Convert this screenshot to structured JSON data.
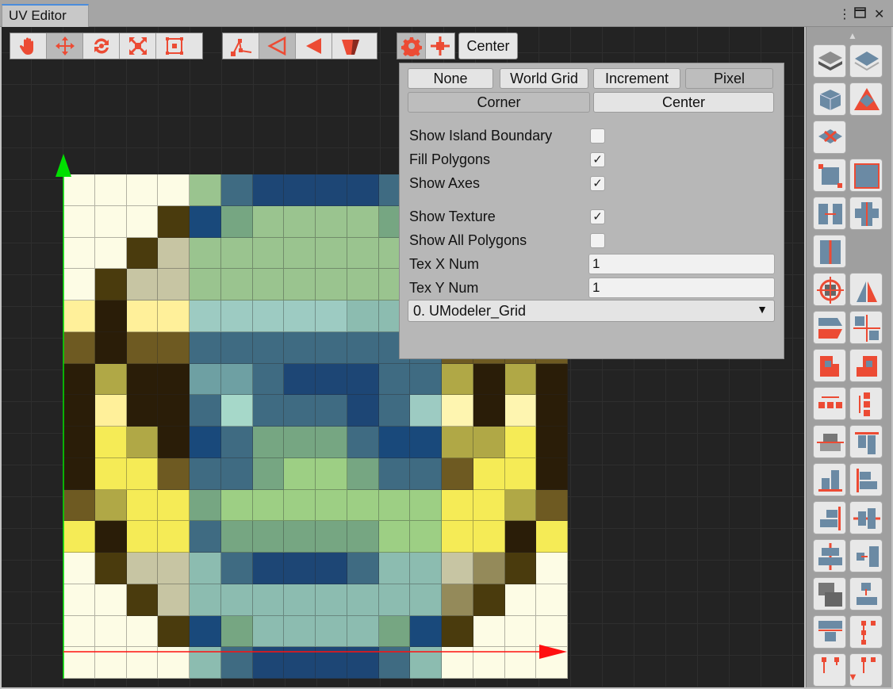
{
  "window": {
    "title": "UV Editor",
    "menu_glyph": "⋮",
    "maximize_glyph": "🗖",
    "close_glyph": "✕"
  },
  "toolbar": {
    "view_tools": [
      {
        "icon": "hand-icon",
        "active": false
      },
      {
        "icon": "move-icon",
        "active": true
      },
      {
        "icon": "rotate-icon",
        "active": false
      },
      {
        "icon": "scale-icon",
        "active": false
      },
      {
        "icon": "rect-transform-icon",
        "active": false
      }
    ],
    "select_modes": [
      {
        "icon": "vertex-select-icon",
        "active": false
      },
      {
        "icon": "edge-select-icon",
        "active": true
      },
      {
        "icon": "face-select-icon",
        "active": false
      },
      {
        "icon": "object-select-icon",
        "active": false
      }
    ],
    "settings_icon": "gear-icon",
    "pivot_icon": "pivot-cross-icon",
    "pivot_label": "Center"
  },
  "panel": {
    "snap_options": [
      "None",
      "World Grid",
      "Increment",
      "Pixel"
    ],
    "snap_selected": "Pixel",
    "pivot_options": [
      "Corner",
      "Center"
    ],
    "pivot_selected": "Corner",
    "options": [
      {
        "label": "Show Island Boundary",
        "checked": false
      },
      {
        "label": "Fill Polygons",
        "checked": true
      },
      {
        "label": "Show Axes",
        "checked": true
      },
      {
        "label": "Show Texture",
        "checked": true
      },
      {
        "label": "Show All Polygons",
        "checked": false
      }
    ],
    "check_glyph": "✓",
    "tex_x_label": "Tex X Num",
    "tex_x_value": "1",
    "tex_y_label": "Tex Y Num",
    "tex_y_value": "1",
    "texture_select": "0. UModeler_Grid",
    "texture_arrow": "▼"
  },
  "texture": {
    "palette": {
      "W": "#fdfce5",
      "D": "#2a1d08",
      "d": "#4a3b0d",
      "O": "#6e5a22",
      "S": "#b0a846",
      "T": "#c7c5a3",
      "Y": "#f5eb56",
      "y": "#fff09a",
      "L": "#fef5b0",
      "K": "#948a5a",
      "g": "#9ac48f",
      "G": "#9dcf84",
      "m": "#76a682",
      "N": "#1d4675",
      "B": "#19497b",
      "b": "#3f6b82",
      "t": "#6ea0a3",
      "c": "#9dcbc2",
      "C": "#a6d8c9",
      "s": "#8cbcb0",
      "P": "#9ad193"
    },
    "rows": [
      "WWWWgbNNNNbWWWWW",
      "WWWdBmggggmWWWWW",
      "WWdTggggggggWWWW",
      "WdTTggggggggTWWW",
      "yDyycccccsscyDyy",
      "ODOObbbbbbbbOOOO",
      "DSDDttbNNNbbSDSD",
      "DyDDbCbbbNbcLDLD",
      "DYSDBbmmmbBBSSYD",
      "DYYObbmGGmbbOYYD",
      "OSYYmGGGGGGGYYSO",
      "YDYYbmmmmmGGYYDY",
      "WdTTsbNNNbssTKdW",
      "WWdTssssssssKdWW",
      "WWWdBmssssmBdWWW",
      "WWWWsbNNNNbsWWWW"
    ]
  },
  "axes": {
    "y_color": "#00e000",
    "x_color": "#ff1010"
  },
  "sidebar": {
    "scroll_up": "▲",
    "scroll_down": "▼",
    "tools": [
      "flatten-plane-icon",
      "project-plane-icon",
      "box-project-icon",
      "triangle-project-icon",
      "remove-uv-icon",
      "",
      "rect-fit-icon",
      "square-fit-icon",
      "split-island-icon",
      "stitch-icon",
      "weld-island-icon",
      "",
      "rotate-island-icon",
      "mirror-island-icon",
      "flip-horizontal-icon",
      "cut-cross-icon",
      "flip-vertical-down-icon",
      "flip-vertical-up-icon",
      "distribute-horizontal-icon",
      "distribute-vertical-icon",
      "align-center-horizontal-icon",
      "align-top-icon",
      "align-bottom-icon",
      "align-left-icon",
      "align-right-icon",
      "align-middle-icon",
      "align-center-vertical-icon",
      "snap-right-icon",
      "stack-island-icon",
      "snap-down-icon",
      "pack-down-icon",
      "pack-vertical-icon",
      "pack-bottom-icon",
      "pack-bottom-right-icon"
    ]
  }
}
